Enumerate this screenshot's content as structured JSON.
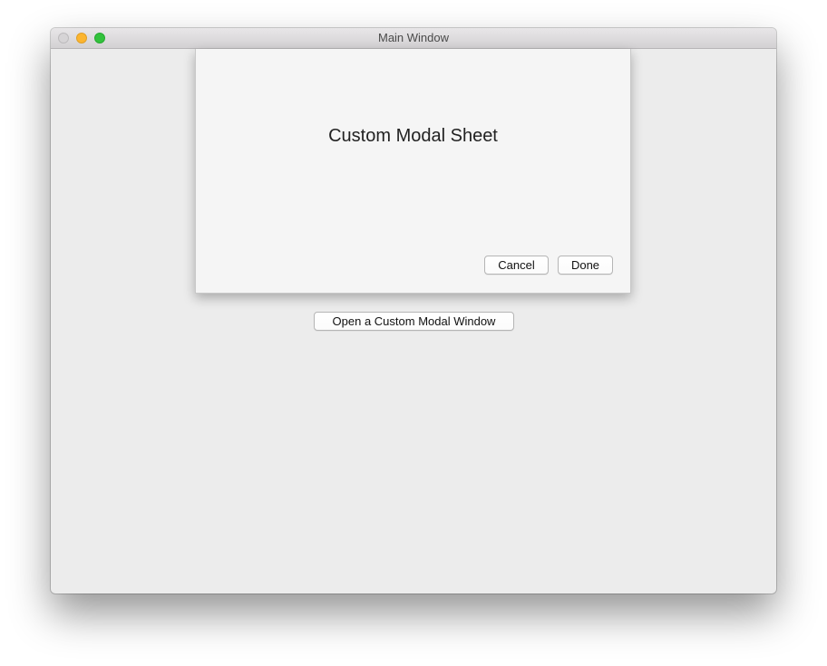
{
  "window": {
    "title": "Main Window"
  },
  "sheet": {
    "heading": "Custom Modal Sheet",
    "cancel_label": "Cancel",
    "done_label": "Done"
  },
  "main": {
    "open_button_label": "Open a Custom Modal Window"
  },
  "colors": {
    "close": "#d6d4d6",
    "minimize": "#fcb52f",
    "zoom": "#32c23c",
    "window_bg": "#ececec",
    "sheet_bg": "#f5f5f5"
  }
}
